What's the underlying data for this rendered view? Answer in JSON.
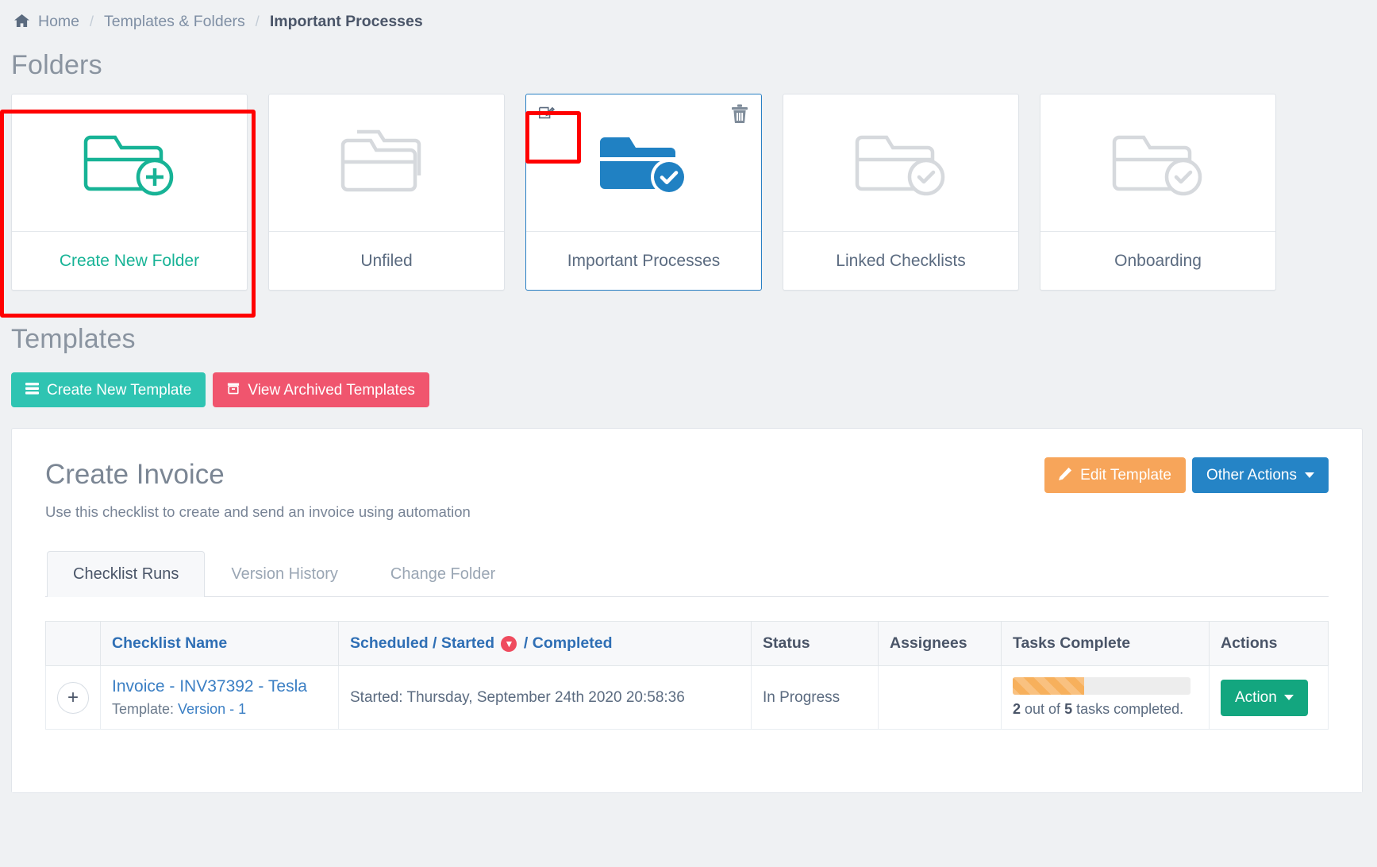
{
  "breadcrumb": {
    "home_icon": "home-icon",
    "home": "Home",
    "separator": "/",
    "middle": "Templates & Folders",
    "current": "Important Processes"
  },
  "folders_section": {
    "title": "Folders",
    "cards": [
      {
        "label": "Create New Folder",
        "icon": "folder-plus-icon",
        "state": "create",
        "highlighted": true
      },
      {
        "label": "Unfiled",
        "icon": "folder-stack-icon",
        "state": "normal",
        "highlighted": false
      },
      {
        "label": "Important Processes",
        "icon": "folder-check-icon",
        "state": "selected",
        "highlighted": false,
        "edit_icon": "edit-pencil-icon",
        "delete_icon": "trash-icon"
      },
      {
        "label": "Linked Checklists",
        "icon": "folder-check-icon",
        "state": "normal",
        "highlighted": false
      },
      {
        "label": "Onboarding",
        "icon": "folder-check-icon",
        "state": "normal",
        "highlighted": false
      }
    ]
  },
  "templates_section": {
    "title": "Templates",
    "create_button": {
      "label": "Create New Template",
      "icon": "list-icon",
      "color": "#2fc4b2"
    },
    "archived_button": {
      "label": "View Archived Templates",
      "icon": "archive-box-icon",
      "color": "#f0556e"
    }
  },
  "template_panel": {
    "title": "Create Invoice",
    "subtitle": "Use this checklist to create and send an invoice using automation",
    "edit_button": {
      "label": "Edit Template",
      "icon": "pencil-icon",
      "color": "#f7a55a"
    },
    "other_actions_button": {
      "label": "Other Actions",
      "color": "#2584c6"
    },
    "tabs": [
      {
        "label": "Checklist Runs",
        "active": true
      },
      {
        "label": "Version History",
        "active": false
      },
      {
        "label": "Change Folder",
        "active": false
      }
    ],
    "table": {
      "headers": {
        "expand": "",
        "checklist_name": "Checklist Name",
        "dates_scheduled": "Scheduled",
        "dates_sep1": "/",
        "dates_started": "Started",
        "dates_sort_icon": "sort-descending-icon",
        "dates_sep2": "/",
        "dates_completed": "Completed",
        "status": "Status",
        "assignees": "Assignees",
        "tasks_complete": "Tasks Complete",
        "actions": "Actions"
      },
      "rows": [
        {
          "expand_label": "+",
          "name": "Invoice - INV37392 - Tesla",
          "template_prefix": "Template: ",
          "template_version": "Version - 1",
          "date": "Started: Thursday, September 24th 2020 20:58:36",
          "status": "In Progress",
          "assignees": "",
          "tasks_done": 2,
          "tasks_total": 5,
          "progress_percent": 40,
          "progress_text_prefix": " out of ",
          "progress_text_suffix": " tasks completed.",
          "action_label": "Action"
        }
      ]
    }
  },
  "annotations": {
    "create_folder_highlight": "red-rectangle-highlight",
    "edit_icon_highlight": "red-rectangle-highlight"
  },
  "colors": {
    "accent_green": "#17b396",
    "accent_blue": "#2584c6",
    "accent_orange": "#f7a55a",
    "accent_red": "#f0556e",
    "accent_teal": "#2fc4b2",
    "highlight": "#ff0000"
  }
}
